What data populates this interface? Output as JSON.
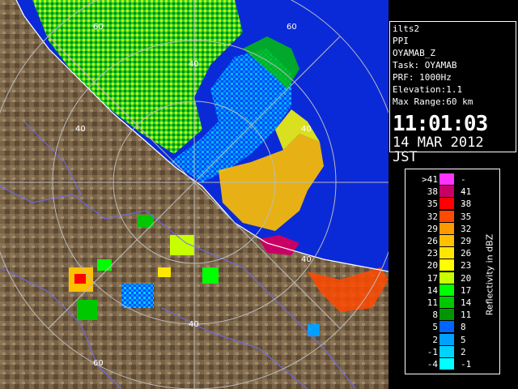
{
  "info": {
    "lines": [
      "ilts2",
      "PPI",
      "OYAMAB_Z",
      "Task: OYAMAB",
      "PRF: 1000Hz",
      "Elevation:1.1",
      "Max Range:60 km"
    ],
    "time": "11:01:03",
    "date": "14 MAR 2012 JST"
  },
  "legend": {
    "caption": "Reflectivity in dBZ",
    "rows": [
      {
        "lo": ">41",
        "hi": "---",
        "color": "#ff33ff"
      },
      {
        "lo": "38",
        "hi": "41",
        "color": "#c80064"
      },
      {
        "lo": "35",
        "hi": "38",
        "color": "#ff0000"
      },
      {
        "lo": "32",
        "hi": "35",
        "color": "#ff4a00"
      },
      {
        "lo": "29",
        "hi": "32",
        "color": "#ff9900"
      },
      {
        "lo": "26",
        "hi": "29",
        "color": "#ffc000"
      },
      {
        "lo": "23",
        "hi": "26",
        "color": "#ffe600"
      },
      {
        "lo": "20",
        "hi": "23",
        "color": "#ffff00"
      },
      {
        "lo": "17",
        "hi": "20",
        "color": "#c8ff00"
      },
      {
        "lo": "14",
        "hi": "17",
        "color": "#00ff00"
      },
      {
        "lo": "11",
        "hi": "14",
        "color": "#00c800"
      },
      {
        "lo": "8",
        "hi": "11",
        "color": "#009600"
      },
      {
        "lo": "5",
        "hi": "8",
        "color": "#0064ff"
      },
      {
        "lo": "2",
        "hi": "5",
        "color": "#00a0ff"
      },
      {
        "lo": "-1",
        "hi": "2",
        "color": "#00d2ff"
      },
      {
        "lo": "-4",
        "hi": "-1",
        "color": "#00ffff"
      }
    ]
  },
  "range_labels": [
    "60",
    "40",
    "40",
    "40",
    "40",
    "40",
    "60",
    "60"
  ],
  "colors": {
    "land": "#7a6448",
    "sea": "#0a2ad8",
    "coast": "#ffffff",
    "ring": "#bbbbbb",
    "border": "#6a6aff"
  }
}
